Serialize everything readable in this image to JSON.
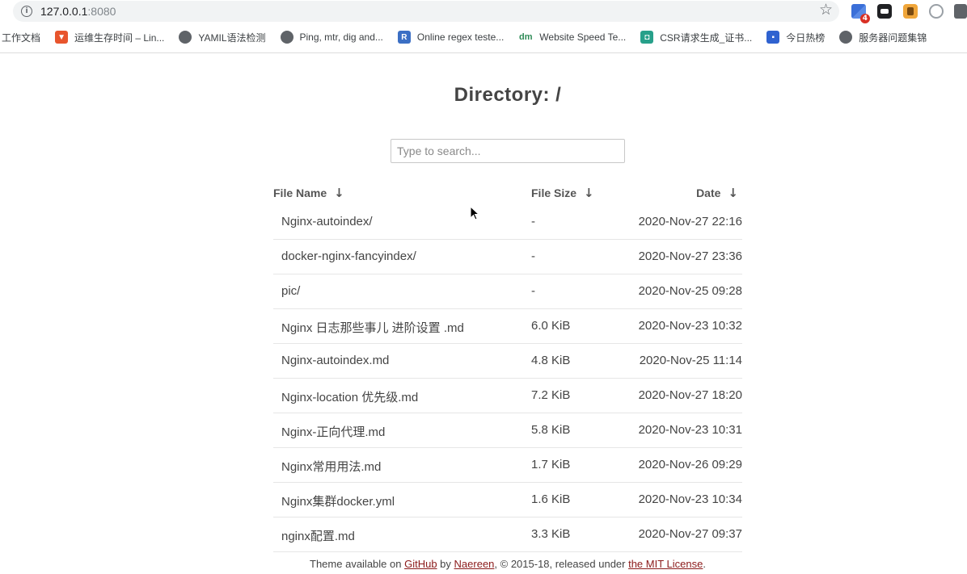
{
  "browser": {
    "url_host": "127.0.0.1",
    "url_port": ":8080",
    "extension_badge": "4",
    "bookmarks": [
      {
        "label": "工作文档",
        "icon": "none"
      },
      {
        "label": "运维生存时间 – Lin...",
        "icon": "brave-icon"
      },
      {
        "label": "YAMIL语法检测",
        "icon": "globe-icon"
      },
      {
        "label": "Ping, mtr, dig and...",
        "icon": "globe-icon"
      },
      {
        "label": "Online regex teste...",
        "icon": "regex-icon",
        "glyph": "R"
      },
      {
        "label": "Website Speed Te...",
        "icon": "dm-icon",
        "glyph": "dm"
      },
      {
        "label": "CSR请求生成_证书...",
        "icon": "csr-icon"
      },
      {
        "label": "今日热榜",
        "icon": "hot-icon"
      },
      {
        "label": "服务器问题集锦",
        "icon": "globe-icon"
      }
    ]
  },
  "page": {
    "title": "Directory: /",
    "search_placeholder": "Type to search..."
  },
  "table": {
    "headers": {
      "name": "File Name",
      "size": "File Size",
      "date": "Date",
      "sort_arrow": "↓"
    },
    "rows": [
      {
        "name": "Nginx-autoindex/",
        "size": "-",
        "date": "2020-Nov-27 22:16"
      },
      {
        "name": "docker-nginx-fancyindex/",
        "size": "-",
        "date": "2020-Nov-27 23:36"
      },
      {
        "name": "pic/",
        "size": "-",
        "date": "2020-Nov-25 09:28"
      },
      {
        "name": "Nginx 日志那些事儿 进阶设置 .md",
        "size": "6.0 KiB",
        "date": "2020-Nov-23 10:32"
      },
      {
        "name": "Nginx-autoindex.md",
        "size": "4.8 KiB",
        "date": "2020-Nov-25 11:14"
      },
      {
        "name": "Nginx-location 优先级.md",
        "size": "7.2 KiB",
        "date": "2020-Nov-27 18:20"
      },
      {
        "name": "Nginx-正向代理.md",
        "size": "5.8 KiB",
        "date": "2020-Nov-23 10:31"
      },
      {
        "name": "Nginx常用用法.md",
        "size": "1.7 KiB",
        "date": "2020-Nov-26 09:29"
      },
      {
        "name": "Nginx集群docker.yml",
        "size": "1.6 KiB",
        "date": "2020-Nov-23 10:34"
      },
      {
        "name": "nginx配置.md",
        "size": "3.3 KiB",
        "date": "2020-Nov-27 09:37"
      }
    ]
  },
  "footer": {
    "prefix": "Theme available on ",
    "github": "GitHub",
    "by": " by ",
    "author": "Naereen",
    "middle": ", © 2015-18, released under ",
    "license": "the MIT License",
    "suffix": "."
  },
  "colors": {
    "link": "#8b1a1a",
    "text": "#444444"
  }
}
